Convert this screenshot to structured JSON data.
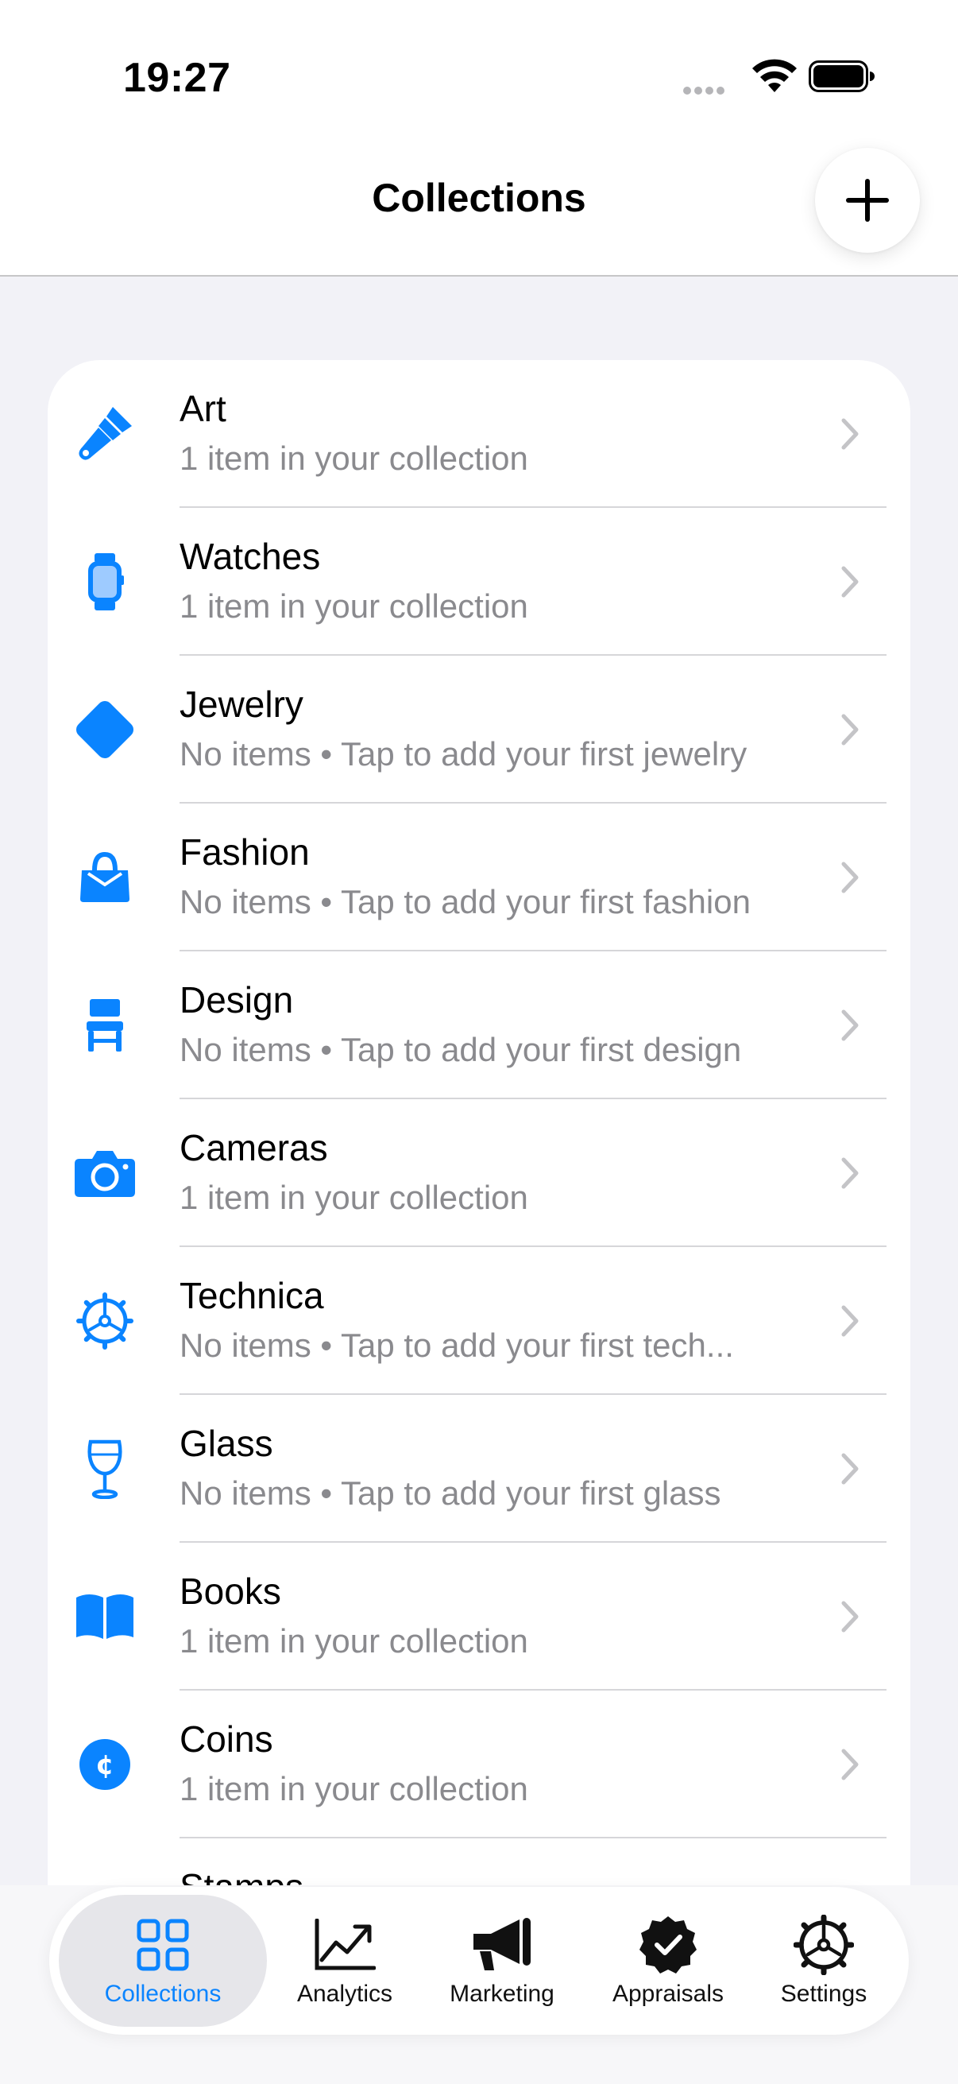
{
  "status_bar": {
    "time": "19:27",
    "icons": [
      "signal-icon",
      "wifi-icon",
      "battery-icon"
    ]
  },
  "header": {
    "title": "Collections",
    "add_icon": "plus-icon"
  },
  "colors": {
    "accent": "#0A84FF",
    "background": "#F2F2F7",
    "secondary_text": "#8A8A8E"
  },
  "collections": [
    {
      "title": "Art",
      "subtitle": "1 item in your collection",
      "icon": "paintbrush-icon"
    },
    {
      "title": "Watches",
      "subtitle": "1 item in your collection",
      "icon": "watch-icon"
    },
    {
      "title": "Jewelry",
      "subtitle": "No items • Tap to add your first jewelry",
      "icon": "diamond-icon"
    },
    {
      "title": "Fashion",
      "subtitle": "No items • Tap to add your first fashion",
      "icon": "handbag-icon"
    },
    {
      "title": "Design",
      "subtitle": "No items • Tap to add your first design",
      "icon": "chair-icon"
    },
    {
      "title": "Cameras",
      "subtitle": "1 item in your collection",
      "icon": "camera-icon"
    },
    {
      "title": "Technica",
      "subtitle": "No items • Tap to add your first tech...",
      "icon": "gear-icon"
    },
    {
      "title": "Glass",
      "subtitle": "No items • Tap to add your first glass",
      "icon": "wineglass-icon"
    },
    {
      "title": "Books",
      "subtitle": "1 item in your collection",
      "icon": "book-icon"
    },
    {
      "title": "Coins",
      "subtitle": "1 item in your collection",
      "icon": "coin-icon"
    },
    {
      "title": "Stamps",
      "subtitle": "",
      "icon": "stamp-icon"
    }
  ],
  "tabbar": {
    "tabs": [
      {
        "label": "Collections",
        "icon": "grid-icon",
        "active": true
      },
      {
        "label": "Analytics",
        "icon": "chart-icon",
        "active": false
      },
      {
        "label": "Marketing",
        "icon": "megaphone-icon",
        "active": false
      },
      {
        "label": "Appraisals",
        "icon": "checkmark-seal-icon",
        "active": false
      },
      {
        "label": "Settings",
        "icon": "gear-icon",
        "active": false
      }
    ]
  }
}
